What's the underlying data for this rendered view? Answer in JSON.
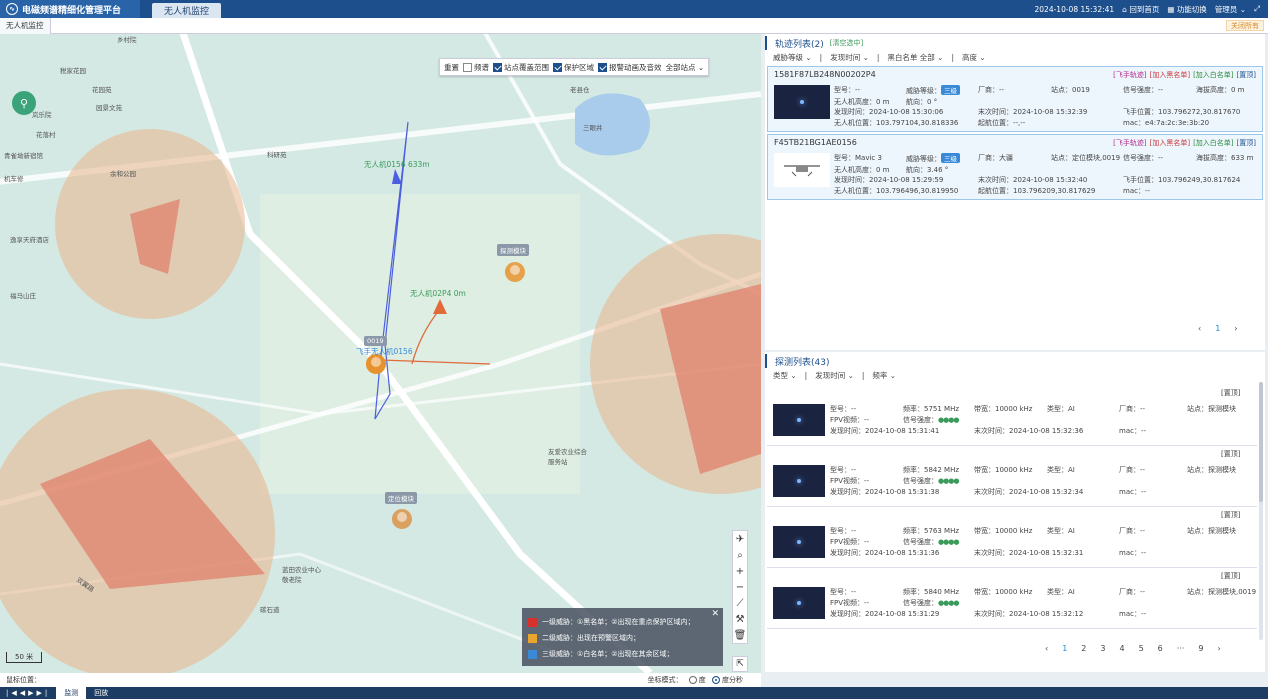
{
  "app": {
    "title": "电磁频谱精细化管理平台",
    "tab": "无人机监控",
    "datetime": "2024-10-08 15:32:41",
    "home": "回到首页",
    "switch": "功能切换",
    "admin": "管理员"
  },
  "subtabs": {
    "current": "无人机监控",
    "close_all": "关闭所有"
  },
  "map": {
    "tools": {
      "reset": "重置",
      "freq": "频谱",
      "station_range": "站点覆盖范围",
      "protect": "保护区域",
      "alarm": "报警动画及音效",
      "all_stations": "全部站点"
    },
    "labels": [
      {
        "t": "乡村院"
      },
      {
        "t": "税家花园"
      },
      {
        "t": "花园苑"
      },
      {
        "t": "园景文苑"
      },
      {
        "t": "花落村"
      },
      {
        "t": "余和公园"
      },
      {
        "t": "青雀坳新宿馆"
      },
      {
        "t": "机车修"
      },
      {
        "t": "岚乐院"
      },
      {
        "t": "逸享天府酒店"
      },
      {
        "t": "福马山庄"
      },
      {
        "t": "三眼井"
      },
      {
        "t": "科研苑"
      },
      {
        "t": "友爱农业综合服务站"
      },
      {
        "t": "蓝田农业中心敬老院"
      },
      {
        "t": "碳石道"
      },
      {
        "t": "双翼路"
      },
      {
        "t": "老县仓"
      }
    ],
    "drone1_label": "无人机0156 633m",
    "drone2_label": "无人机02P4 0m",
    "pin_station": "0019",
    "pin_station_sub": "飞手无人机0156",
    "pin_detect": "探测模块",
    "pin_locate": "定位模块",
    "scale": "50 米",
    "legend": [
      {
        "color": "#d8302c",
        "text": "一级威胁：①黑名单；②出现在重点保护区域内；"
      },
      {
        "color": "#e9a52e",
        "text": "二级威胁：出现在预警区域内；"
      },
      {
        "color": "#3a8ad8",
        "text": "三级威胁：①白名单；②出现在其余区域；"
      }
    ],
    "mouse_pos": "鼠标位置：",
    "coord_mode": "坐标模式：",
    "coord_deg": "度",
    "coord_dms": "度分秒"
  },
  "footer": {
    "live": "监测",
    "playback": "回放"
  },
  "track": {
    "title": "轨迹列表(2)",
    "clear": "[清空选中]",
    "filters": [
      "威胁等级",
      "发现时间",
      "黑白名单 全部",
      "高度"
    ],
    "pager": {
      "page": "1"
    },
    "items": [
      {
        "id": "1581F87LB248N00202P4",
        "acts": [
          "[飞手轨迹]",
          "[加入黑名单]",
          "[加入白名单]",
          "[置顶]"
        ],
        "model": "型号：--",
        "threat": "威胁等级：",
        "level": "三级",
        "vendor": "厂商：--",
        "station": "站点：0019",
        "signal": "信号强度：--",
        "sea": "海拔高度：0 m",
        "height": "无人机高度：0 m",
        "heading": "航向：0 °",
        "found": "发现时间：2024-10-08 15:30:06",
        "last": "末次时间：2024-10-08 15:32:39",
        "pilot": "飞手位置：103.796272,30.817670",
        "pos": "无人机位置：103.797104,30.818336",
        "takeoff": "起航位置：--,--",
        "mac": "mac：e4:7a:2c:3e:3b:20"
      },
      {
        "id": "F45TB21BG1AE0156",
        "acts": [
          "[飞手轨迹]",
          "[加入黑名单]",
          "[加入白名单]",
          "[置顶]"
        ],
        "model": "型号：Mavic 3",
        "threat": "威胁等级：",
        "level": "三级",
        "vendor": "厂商：大疆",
        "station": "站点：定位模块,0019",
        "signal": "信号强度：--",
        "sea": "海拔高度：633 m",
        "height": "无人机高度：0 m",
        "heading": "航向：3.46 °",
        "found": "发现时间：2024-10-08 15:29:59",
        "last": "末次时间：2024-10-08 15:32:40",
        "pilot": "飞手位置：103.796249,30.817624",
        "pos": "无人机位置：103.796496,30.819950",
        "takeoff": "起航位置：103.796209,30.817629",
        "mac": "mac：--"
      }
    ]
  },
  "detect": {
    "title": "探测列表(43)",
    "filters": [
      "类型",
      "发现时间",
      "频率"
    ],
    "top": "[置顶]",
    "items": [
      {
        "model": "型号：--",
        "freq": "频率：5751 MHz",
        "bw": "带宽：10000 kHz",
        "type": "类型：AI",
        "vendor": "厂商：--",
        "station": "站点：探测模块",
        "fpv": "FPV视频：--",
        "signal": "信号强度：",
        "found": "发现时间：2024-10-08 15:31:41",
        "last": "末次时间：2024-10-08 15:32:36",
        "mac": "mac：--"
      },
      {
        "model": "型号：--",
        "freq": "频率：5842 MHz",
        "bw": "带宽：10000 kHz",
        "type": "类型：AI",
        "vendor": "厂商：--",
        "station": "站点：探测模块",
        "fpv": "FPV视频：--",
        "signal": "信号强度：",
        "found": "发现时间：2024-10-08 15:31:38",
        "last": "末次时间：2024-10-08 15:32:34",
        "mac": "mac：--"
      },
      {
        "model": "型号：--",
        "freq": "频率：5763 MHz",
        "bw": "带宽：10000 kHz",
        "type": "类型：AI",
        "vendor": "厂商：--",
        "station": "站点：探测模块",
        "fpv": "FPV视频：--",
        "signal": "信号强度：",
        "found": "发现时间：2024-10-08 15:31:36",
        "last": "末次时间：2024-10-08 15:32:31",
        "mac": "mac：--"
      },
      {
        "model": "型号：--",
        "freq": "频率：5840 MHz",
        "bw": "带宽：10000 kHz",
        "type": "类型：AI",
        "vendor": "厂商：--",
        "station": "站点：探测模块,0019",
        "fpv": "FPV视频：--",
        "signal": "信号强度：",
        "found": "发现时间：2024-10-08 15:31:29",
        "last": "末次时间：2024-10-08 15:32:12",
        "mac": "mac：--"
      }
    ],
    "pages": [
      "1",
      "2",
      "3",
      "4",
      "5",
      "6",
      "···",
      "9"
    ]
  }
}
